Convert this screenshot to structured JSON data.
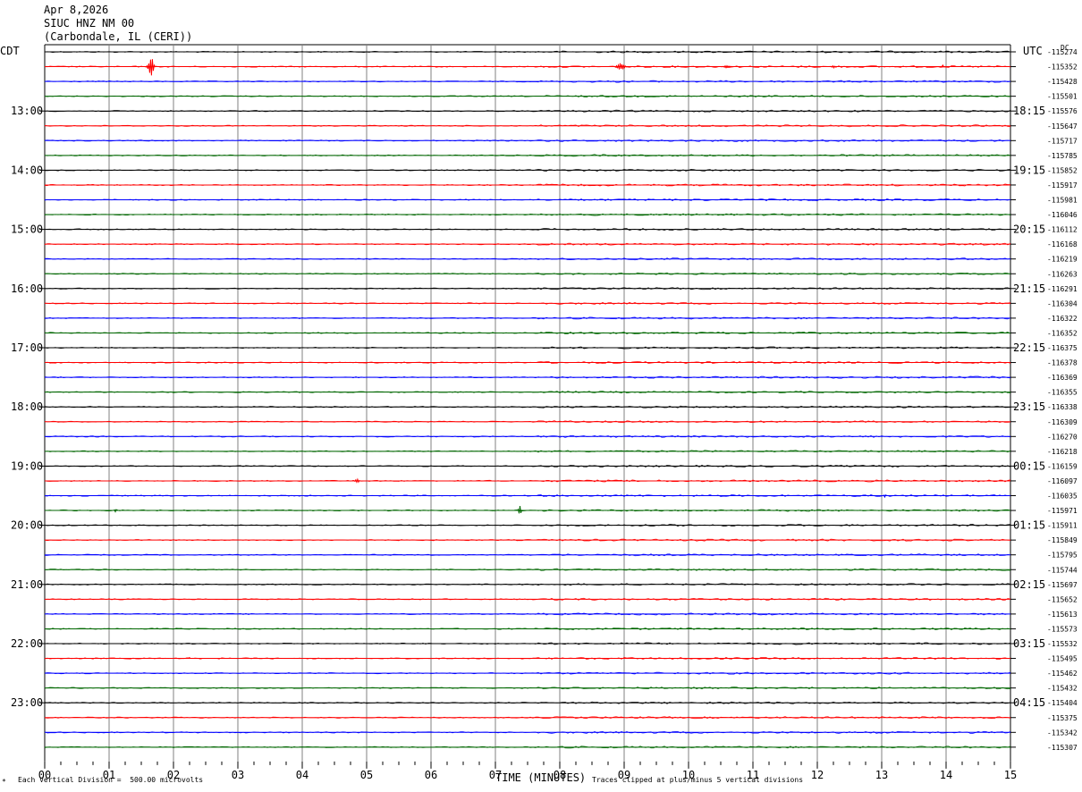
{
  "header": {
    "date": "Apr 8,2026",
    "station": "SIUC HNZ NM 00",
    "location": "(Carbondale, IL (CERI))"
  },
  "chart_data": {
    "type": "line",
    "title": "",
    "xlabel": "TIME (MINUTES)",
    "xlim": [
      0,
      15
    ],
    "x_ticks": [
      "00",
      "01",
      "02",
      "03",
      "04",
      "05",
      "06",
      "07",
      "08",
      "09",
      "10",
      "11",
      "12",
      "13",
      "14",
      "15"
    ],
    "left_axis_label": "CDT",
    "right_axis_label": "UTC",
    "right_corner_label": "DC",
    "left_hour_labels": [
      "13:00",
      "14:00",
      "15:00",
      "16:00",
      "17:00",
      "18:00",
      "19:00",
      "20:00",
      "21:00",
      "22:00",
      "23:00"
    ],
    "right_hour_labels": [
      "18:15",
      "19:15",
      "20:15",
      "21:15",
      "22:15",
      "23:15",
      "00:15",
      "01:15",
      "02:15",
      "03:15",
      "04:15"
    ],
    "dc_offsets": [
      "-115274",
      "-115352",
      "-115428",
      "-115501",
      "-115576",
      "-115647",
      "-115717",
      "-115785",
      "-115852",
      "-115917",
      "-115981",
      "-116046",
      "-116112",
      "-116168",
      "-116219",
      "-116263",
      "-116291",
      "-116304",
      "-116322",
      "-116352",
      "-116375",
      "-116378",
      "-116369",
      "-116355",
      "-116338",
      "-116309",
      "-116270",
      "-116218",
      "-116159",
      "-116097",
      "-116035",
      "-115971",
      "-115911",
      "-115849",
      "-115795",
      "-115744",
      "-115697",
      "-115652",
      "-115613",
      "-115573",
      "-115532",
      "-115495",
      "-115462",
      "-115432",
      "-115404",
      "-115375",
      "-115342",
      "-115307"
    ],
    "trace_colors": [
      "#000000",
      "#ff0000",
      "#0000ff",
      "#006600"
    ],
    "grid_color": "#808080",
    "traces_per_hour": 4,
    "events": [
      {
        "trace": 1,
        "minute": 1.65,
        "amplitude": 1.0,
        "width": 0.15
      },
      {
        "trace": 1,
        "minute": 8.95,
        "amplitude": 0.35,
        "width": 0.22
      },
      {
        "trace": 1,
        "minute": 10.6,
        "amplitude": 0.12,
        "width": 0.2
      },
      {
        "trace": 1,
        "minute": 12.25,
        "amplitude": 0.12,
        "width": 0.1
      },
      {
        "trace": 1,
        "minute": 13.95,
        "amplitude": 0.18,
        "width": 0.03
      },
      {
        "trace": 29,
        "minute": 4.85,
        "amplitude": 0.18,
        "width": 0.12
      },
      {
        "trace": 30,
        "minute": 13.05,
        "amplitude": 0.15,
        "width": 0.06
      },
      {
        "trace": 31,
        "minute": 7.38,
        "amplitude": 0.45,
        "width": 0.08
      },
      {
        "trace": 31,
        "minute": 1.1,
        "amplitude": 0.15,
        "width": 0.06
      },
      {
        "trace": 41,
        "minute": 2.25,
        "amplitude": 0.15,
        "width": 0.03
      }
    ]
  },
  "footer": {
    "scale_note": "Each Vertical Division =  500.00 microvolts",
    "clip_note": "Traces clipped at plus/minus 5 vertical divisions"
  }
}
